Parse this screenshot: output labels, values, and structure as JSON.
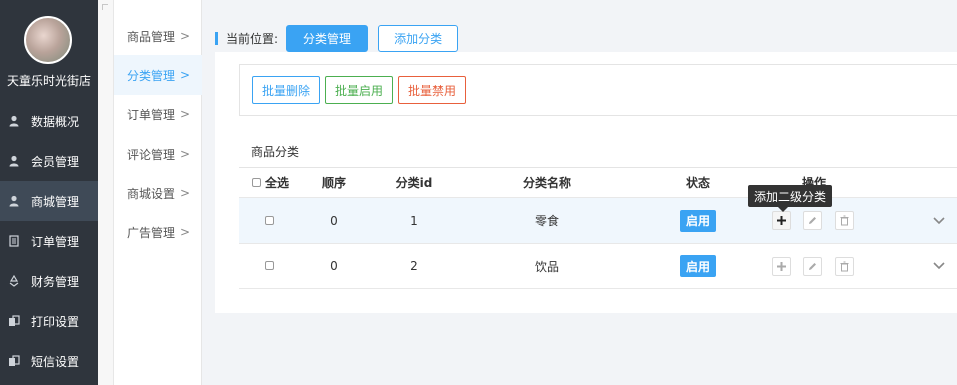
{
  "store": {
    "name": "天童乐时光街店"
  },
  "nav": [
    {
      "label": "数据概况",
      "icon": "user-icon"
    },
    {
      "label": "会员管理",
      "icon": "user-icon"
    },
    {
      "label": "商城管理",
      "icon": "user-icon",
      "active": true
    },
    {
      "label": "订单管理",
      "icon": "document-icon"
    },
    {
      "label": "财务管理",
      "icon": "recycle-icon"
    },
    {
      "label": "打印设置",
      "icon": "copy-icon"
    },
    {
      "label": "短信设置",
      "icon": "copy-icon"
    }
  ],
  "submenu": [
    {
      "label": "商品管理",
      "arrow": ">"
    },
    {
      "label": "分类管理",
      "arrow": ">",
      "active": true
    },
    {
      "label": "订单管理",
      "arrow": ">"
    },
    {
      "label": "评论管理",
      "arrow": ">"
    },
    {
      "label": "商城设置",
      "arrow": ">"
    },
    {
      "label": "广告管理",
      "arrow": ">"
    }
  ],
  "breadcrumb": {
    "label": "当前位置:",
    "current": "分类管理",
    "add": "添加分类"
  },
  "toolbar": {
    "batch_delete": "批量删除",
    "batch_enable": "批量启用",
    "batch_disable": "批量禁用"
  },
  "table": {
    "title": "商品分类",
    "headers": {
      "select_all": "全选",
      "order": "顺序",
      "id": "分类id",
      "name": "分类名称",
      "status": "状态",
      "actions": "操作"
    },
    "rows": [
      {
        "order": "0",
        "id": "1",
        "name": "零食",
        "status": "启用"
      },
      {
        "order": "0",
        "id": "2",
        "name": "饮品",
        "status": "启用"
      }
    ]
  },
  "tooltip": "添加二级分类",
  "colors": {
    "accent": "#3aa3f3",
    "sidebar": "#2f353d",
    "green": "#4caf50",
    "red": "#e8603c"
  }
}
